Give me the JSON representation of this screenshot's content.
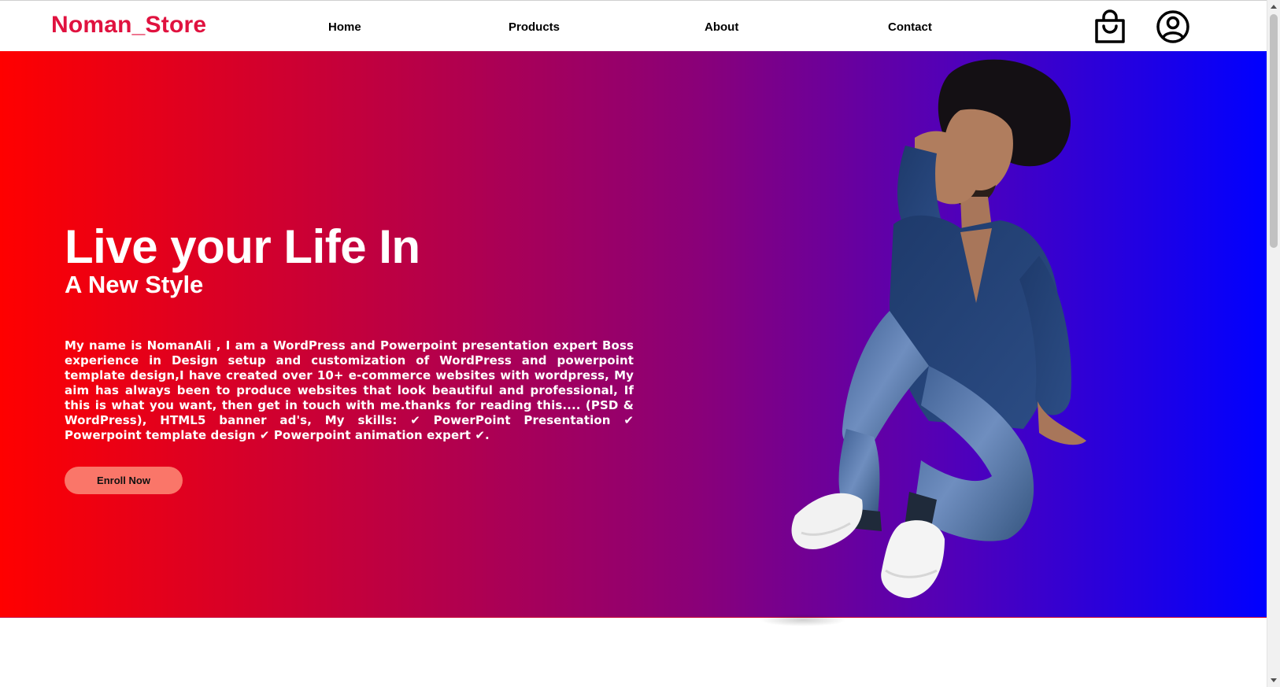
{
  "header": {
    "logo": "Noman_Store",
    "nav": [
      {
        "label": "Home"
      },
      {
        "label": "Products"
      },
      {
        "label": "About"
      },
      {
        "label": "Contact"
      }
    ],
    "icons": [
      "shopping-bag-icon",
      "user-account-icon"
    ]
  },
  "hero": {
    "title": "Live your Life In",
    "subtitle": "A New Style",
    "text": "My name is NomanAli , I am a WordPress and Powerpoint presentation expert Boss experience in Design setup and customization of WordPress and powerpoint template design,I have created over 10+ e-commerce websites with wordpress, My aim has always been to produce websites that look beautiful and professional, If this is what you want, then get in touch with me.thanks for reading this.... (PSD & WordPress), HTML5 banner ad's, My skills: ✔ PowerPoint Presentation ✔ Powerpoint template design ✔ Powerpoint animation expert ✔.",
    "button_label": "Enroll Now",
    "image": "man-in-denim-shirt-and-jeans-sitting"
  },
  "colors": {
    "brand": "#e0123f",
    "gradient_start": "#ff0000",
    "gradient_end": "#0000ff",
    "button_bg": "#fa7669"
  }
}
